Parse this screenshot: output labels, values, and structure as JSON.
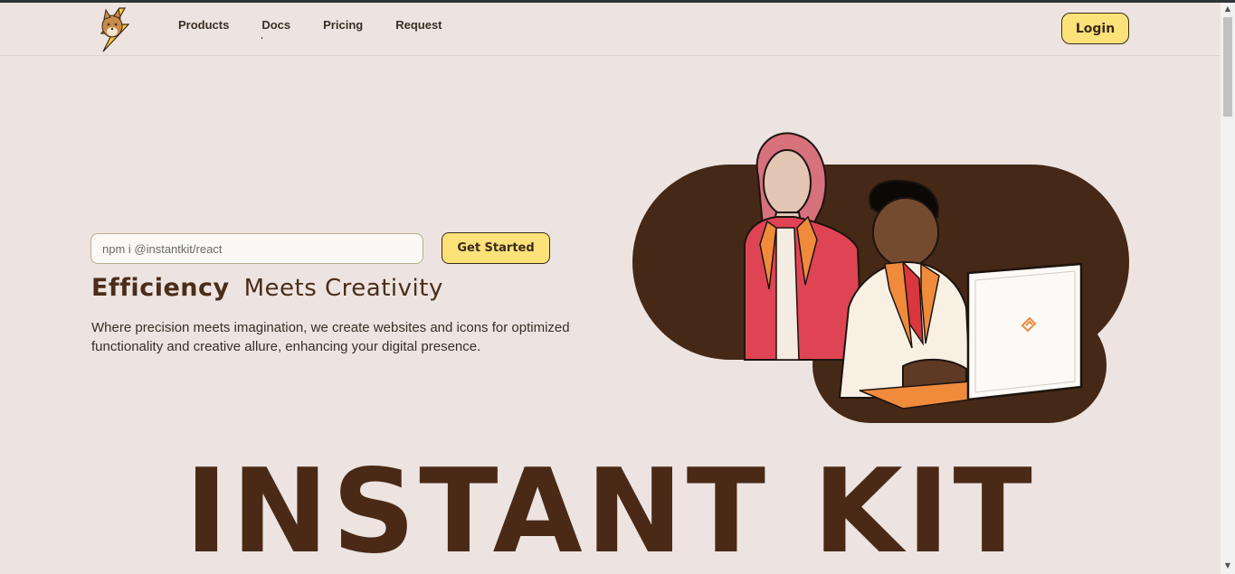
{
  "nav": {
    "logo_icon": "fox-lightning-logo-icon",
    "links": [
      "Products",
      "Docs",
      "Pricing",
      "Request"
    ],
    "login_label": "Login"
  },
  "hero": {
    "install_placeholder": "npm i @instantkit/react",
    "cta_label": "Get Started",
    "headline_bold": "Efficiency",
    "headline_rest": "Meets Creativity",
    "description": "Where precision meets imagination, we create websites and icons for optimized functionality and creative allure, enhancing your digital presence.",
    "illustration_icon": "people-at-computer-illustration"
  },
  "brand": {
    "big_title": "INSTANT KIT"
  },
  "colors": {
    "background": "#ede4e1",
    "accent_yellow": "#fde27a",
    "brown_dark": "#4a2a17"
  }
}
